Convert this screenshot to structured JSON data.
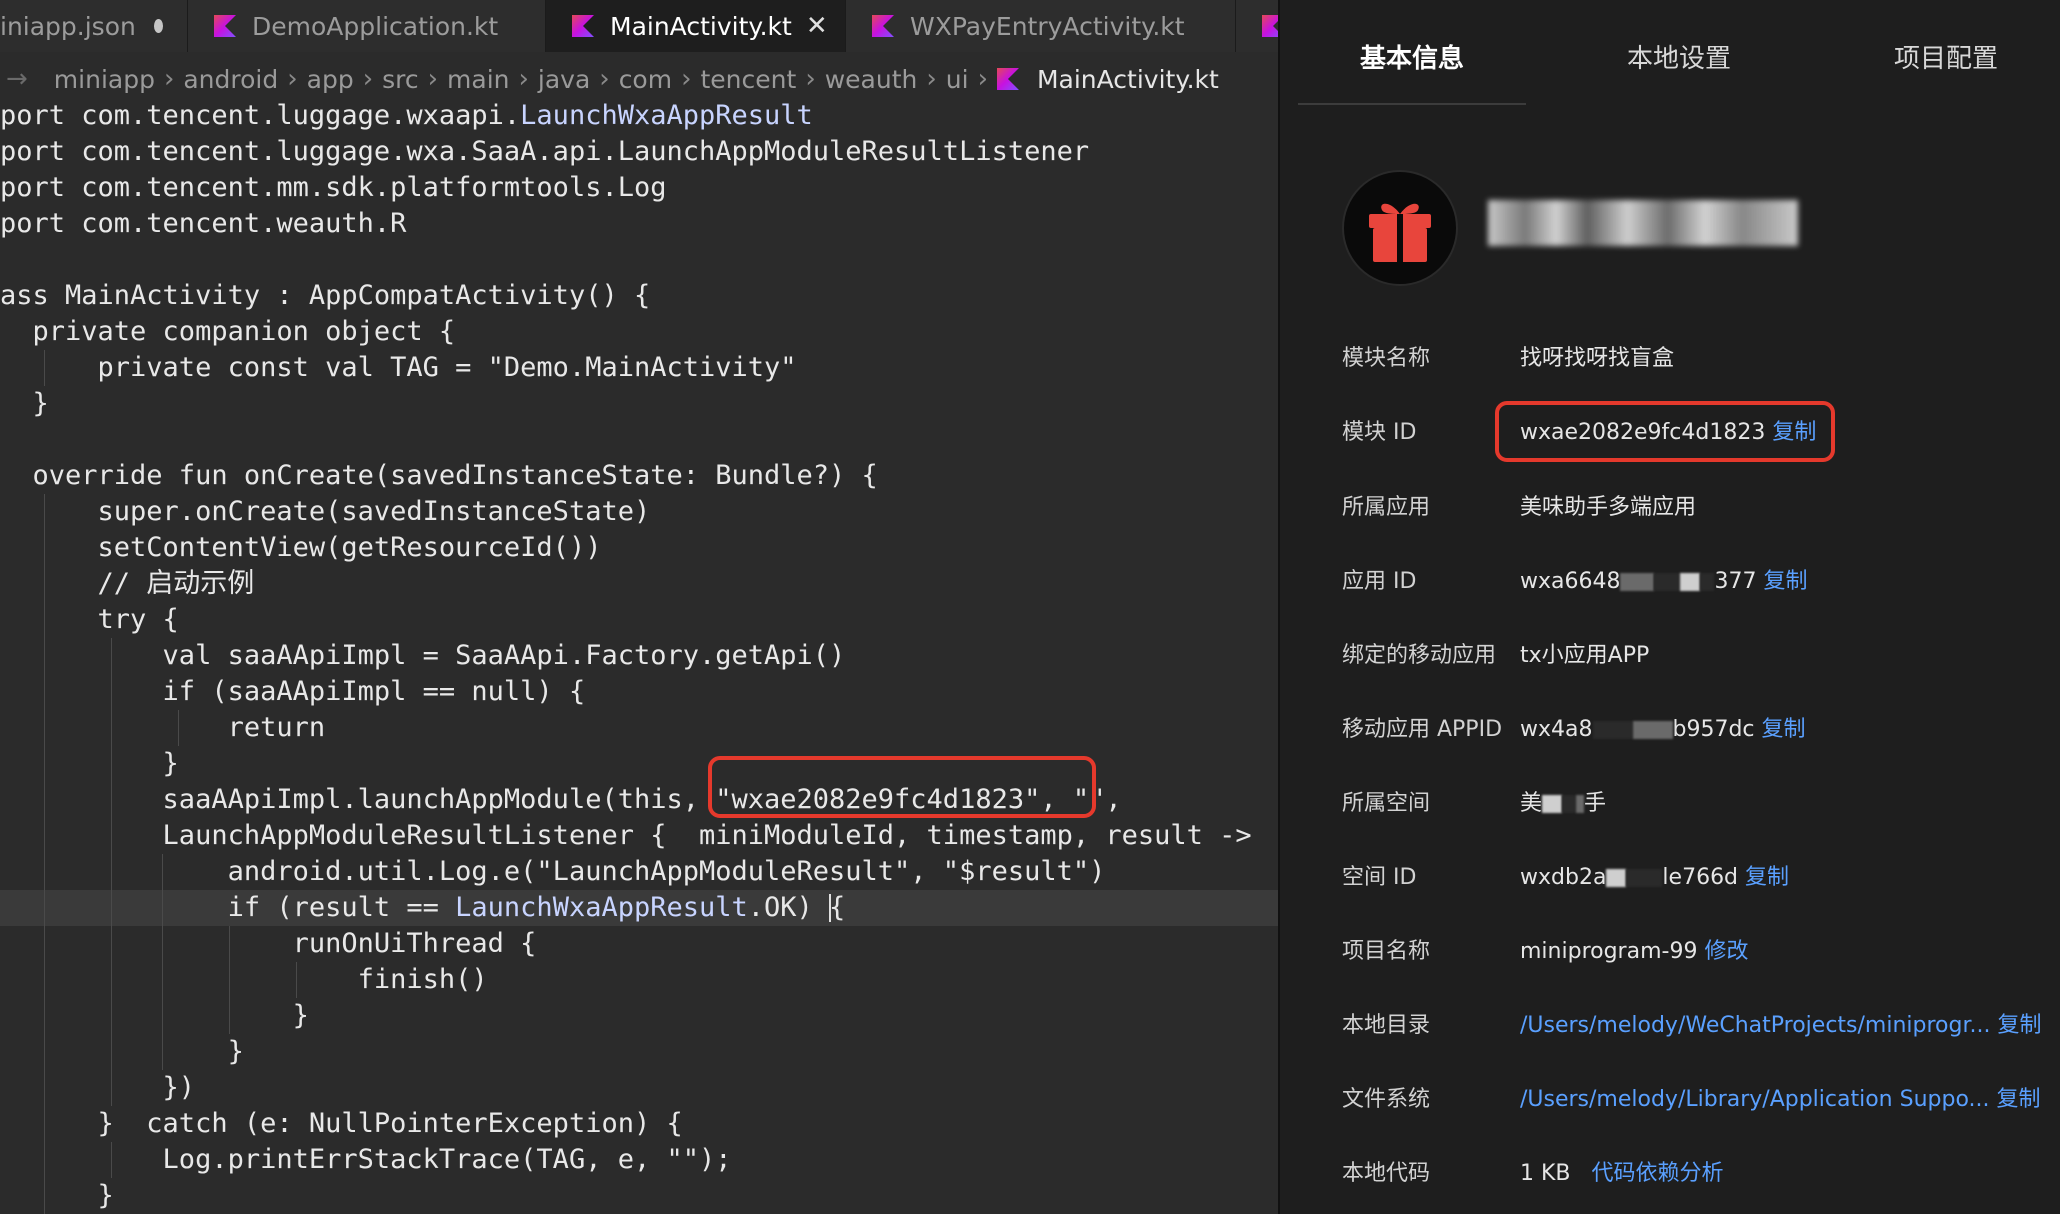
{
  "colors": {
    "highlight_box": "#e5392c",
    "link": "#5aa0ff",
    "editor_bg": "#2b2b2b",
    "panel_bg": "#1e1e1e"
  },
  "tabs": [
    {
      "label": "iniapp.json",
      "modified": true,
      "icon": "json-file-icon"
    },
    {
      "label": "DemoApplication.kt",
      "icon": "kotlin-file-icon"
    },
    {
      "label": "MainActivity.kt",
      "active": true,
      "icon": "kotlin-file-icon",
      "close": "✕"
    },
    {
      "label": "WXPayEntryActivity.kt",
      "icon": "kotlin-file-icon"
    }
  ],
  "breadcrumb": {
    "arrow": "→",
    "separator": "›",
    "items": [
      "miniapp",
      "android",
      "app",
      "src",
      "main",
      "java",
      "com",
      "tencent",
      "weauth",
      "ui"
    ],
    "file": "MainActivity.kt"
  },
  "code": {
    "l1": "port com.tencent.luggage.wxaapi.",
    "l1b": "LaunchWxaAppResult",
    "l2": "port com.tencent.luggage.wxa.SaaA.api.LaunchAppModuleResultListener",
    "l3": "port com.tencent.mm.sdk.platformtools.Log",
    "l4": "port com.tencent.weauth.R",
    "l5": "",
    "l6": "ass MainActivity : AppCompatActivity() {",
    "l7": "  private companion object {",
    "l8": "      private const val TAG = \"Demo.MainActivity\"",
    "l9": "  }",
    "l10": "",
    "l11": "  override fun onCreate(savedInstanceState: Bundle?) {",
    "l12": "      super.onCreate(savedInstanceState)",
    "l13": "      setContentView(getResourceId())",
    "l14": "      // 启动示例",
    "l15": "      try {",
    "l16": "          val saaAApiImpl = SaaAApi.Factory.getApi()",
    "l17": "          if (saaAApiImpl == null) {",
    "l18": "              return",
    "l19": "          }",
    "l20": "          saaAApiImpl.launchAppModule(this, \"wxae2082e9fc4d1823\", \"\",",
    "l21": "          LaunchAppModuleResultListener {  miniModuleId, timestamp, result ->",
    "l22": "              android.util.Log.e(\"LaunchAppModuleResult\", \"$result\")",
    "l23a": "              if (result == ",
    "l23b": "LaunchWxaAppResult",
    "l23c": ".OK) {",
    "l24": "                  runOnUiThread {",
    "l25": "                      finish()",
    "l26": "                  }",
    "l27": "              }",
    "l28": "          })",
    "l29": "      }  catch (e: NullPointerException) {",
    "l30": "          Log.printErrStackTrace(TAG, e, \"\");",
    "l31": "      }"
  },
  "panel": {
    "tabs": [
      "基本信息",
      "本地设置",
      "项目配置"
    ],
    "avatar_icon": "gift-icon",
    "rows": {
      "module_name": {
        "label": "模块名称",
        "value": "找呀找呀找盲盒"
      },
      "module_id": {
        "label": "模块 ID",
        "value": "wxae2082e9fc4d1823",
        "action": "复制"
      },
      "app": {
        "label": "所属应用",
        "value": "美味助手多端应用"
      },
      "app_id": {
        "label": "应用 ID",
        "value_start": "wxa6648",
        "value_end": "377",
        "action": "复制"
      },
      "bound_app": {
        "label": "绑定的移动应用",
        "value": "tx小应用APP"
      },
      "mobile_appid": {
        "label": "移动应用 APPID",
        "value_start": "wx4a8",
        "value_end": "b957dc",
        "action": "复制"
      },
      "space": {
        "label": "所属空间",
        "value_start": "美",
        "value_end": "手"
      },
      "space_id": {
        "label": "空间 ID",
        "value_start": "wxdb2a",
        "value_end": "le766d",
        "action": "复制"
      },
      "project_name": {
        "label": "项目名称",
        "value": "miniprogram-99",
        "action": "修改"
      },
      "local_dir": {
        "label": "本地目录",
        "value": "/Users/melody/WeChatProjects/miniprogr...",
        "action": "复制"
      },
      "file_system": {
        "label": "文件系统",
        "value": "/Users/melody/Library/Application Suppo...",
        "action": "复制"
      },
      "local_code": {
        "label": "本地代码",
        "value": "1 KB",
        "action": "代码依赖分析"
      }
    }
  }
}
